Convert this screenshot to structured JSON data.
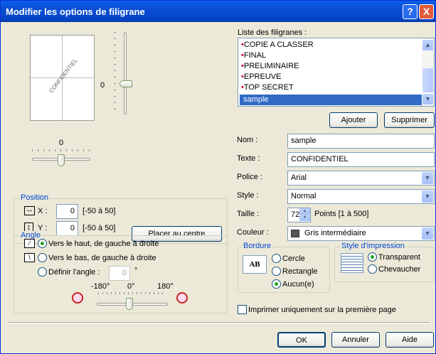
{
  "window": {
    "title": "Modifier les options de filigrane",
    "help_glyph": "?",
    "close_glyph": "X"
  },
  "preview": {
    "watermark_text": "CONFIDENTIEL",
    "vertical_slider_value": "0",
    "horizontal_slider_value": "0"
  },
  "position": {
    "title": "Position",
    "x_label": "X :",
    "x_value": "0",
    "x_range": "[-50 à 50]",
    "y_label": "Y :",
    "y_value": "0",
    "y_range": "[-50 à 50]",
    "center_button": "Placer au centre"
  },
  "angle": {
    "title": "Angle",
    "option_up": "Vers le haut, de gauche à droite",
    "option_down": "Vers le bas, de gauche à droite",
    "option_custom": "Définir l'angle :",
    "custom_value": "0",
    "degree_symbol": "°",
    "tick_min": "-180°",
    "tick_mid": "0°",
    "tick_max": "180°"
  },
  "watermark_list": {
    "label": "Liste des filigranes :",
    "items": [
      "COPIE A CLASSER",
      "FINAL",
      "PRELIMINAIRE",
      "EPREUVE",
      "TOP SECRET",
      "sample"
    ],
    "selected_index": 5,
    "add_button": "Ajouter",
    "delete_button": "Supprimer"
  },
  "form": {
    "name_label": "Nom :",
    "name_value": "sample",
    "text_label": "Texte :",
    "text_value": "CONFIDENTIEL",
    "font_label": "Police :",
    "font_value": "Arial",
    "style_label": "Style :",
    "style_value": "Normal",
    "size_label": "Taille :",
    "size_value": "72",
    "size_unit": "Points [1 à 500]",
    "color_label": "Couleur :",
    "color_value": "Gris intermédiaire",
    "color_swatch": "#555555"
  },
  "border": {
    "title": "Bordure",
    "icon_text": "AB",
    "circle": "Cercle",
    "rectangle": "Rectangle",
    "none": "Aucun(e)"
  },
  "print_style": {
    "title": "Style d'impression",
    "transparent": "Transparent",
    "overlap": "Chevaucher"
  },
  "first_page_only": "Imprimer uniquement sur la première page",
  "buttons": {
    "ok": "OK",
    "cancel": "Annuler",
    "help": "Aide"
  }
}
